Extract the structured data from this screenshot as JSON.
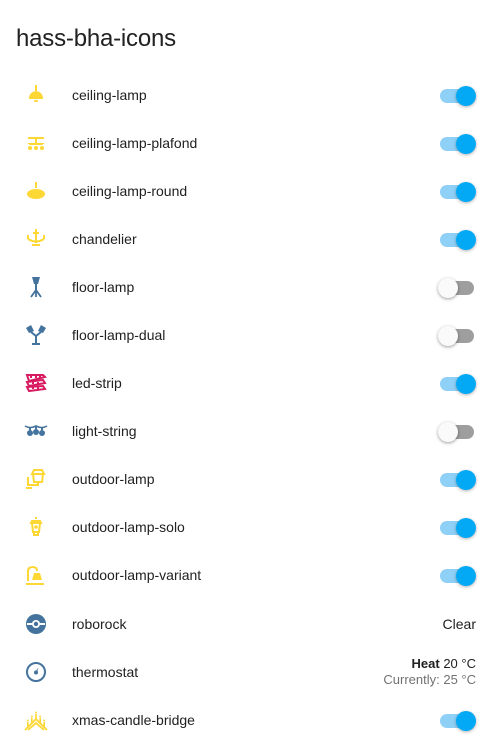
{
  "title": "hass-bha-icons",
  "colors": {
    "icon_yellow": "#fdd835",
    "icon_blue": "#44739e",
    "icon_pink": "#d81b60",
    "accent": "#03a9f4"
  },
  "rows": [
    {
      "name": "ceiling-lamp",
      "icon": "ceiling-lamp-icon",
      "state": "on"
    },
    {
      "name": "ceiling-lamp-plafond",
      "icon": "ceiling-lamp-plafond-icon",
      "state": "on"
    },
    {
      "name": "ceiling-lamp-round",
      "icon": "ceiling-lamp-round-icon",
      "state": "on"
    },
    {
      "name": "chandelier",
      "icon": "chandelier-icon",
      "state": "on"
    },
    {
      "name": "floor-lamp",
      "icon": "floor-lamp-icon",
      "state": "off"
    },
    {
      "name": "floor-lamp-dual",
      "icon": "floor-lamp-dual-icon",
      "state": "off"
    },
    {
      "name": "led-strip",
      "icon": "led-strip-icon",
      "state": "on"
    },
    {
      "name": "light-string",
      "icon": "light-string-icon",
      "state": "off"
    },
    {
      "name": "outdoor-lamp",
      "icon": "outdoor-lamp-icon",
      "state": "on"
    },
    {
      "name": "outdoor-lamp-solo",
      "icon": "outdoor-lamp-solo-icon",
      "state": "on"
    },
    {
      "name": "outdoor-lamp-variant",
      "icon": "outdoor-lamp-variant-icon",
      "state": "on"
    },
    {
      "name": "roborock",
      "icon": "robot-vacuum-icon",
      "action_label": "Clear"
    },
    {
      "name": "thermostat",
      "icon": "thermostat-icon",
      "climate": {
        "mode": "Heat",
        "target": "20 °C",
        "current": "Currently: 25 °C"
      }
    },
    {
      "name": "xmas-candle-bridge",
      "icon": "xmas-candle-bridge-icon",
      "state": "on"
    }
  ]
}
